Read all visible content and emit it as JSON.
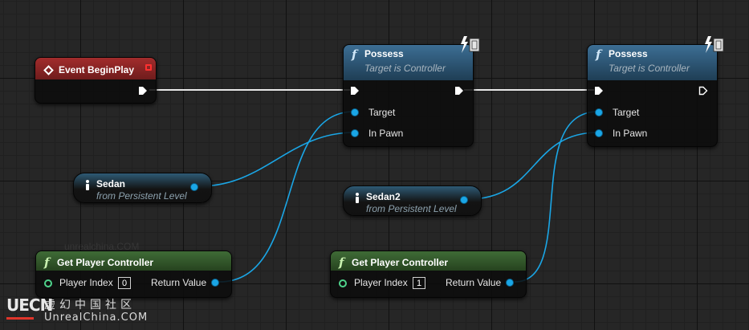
{
  "event_node": {
    "title": "Event BeginPlay"
  },
  "possess_nodes": [
    {
      "title": "Possess",
      "subtitle": "Target is Controller",
      "pins": {
        "target": "Target",
        "in_pawn": "In Pawn"
      }
    },
    {
      "title": "Possess",
      "subtitle": "Target is Controller",
      "pins": {
        "target": "Target",
        "in_pawn": "In Pawn"
      }
    }
  ],
  "variable_nodes": [
    {
      "name": "Sedan",
      "source": "from Persistent Level"
    },
    {
      "name": "Sedan2",
      "source": "from Persistent Level"
    }
  ],
  "get_player_controller_nodes": [
    {
      "title": "Get Player Controller",
      "input_label": "Player Index",
      "input_value": "0",
      "output_label": "Return Value"
    },
    {
      "title": "Get Player Controller",
      "input_label": "Player Index",
      "input_value": "1",
      "output_label": "Return Value"
    }
  ],
  "watermark": {
    "logo": "UECN",
    "cn": "虚幻中国社区",
    "en": "UnrealChina.COM",
    "faint": "unrealchina.COM"
  },
  "colors": {
    "exec_wire": "#ffffff",
    "object_wire": "#1aa6e6",
    "event_header": "#a22c2c",
    "function_header": "#3c6e94",
    "pure_function_header": "#3f6b36"
  },
  "icons": [
    "function-icon",
    "event-diamond-icon",
    "lightning-icon",
    "person-icon",
    "exec-pin-icon",
    "object-pin-icon",
    "integer-pin-icon"
  ]
}
